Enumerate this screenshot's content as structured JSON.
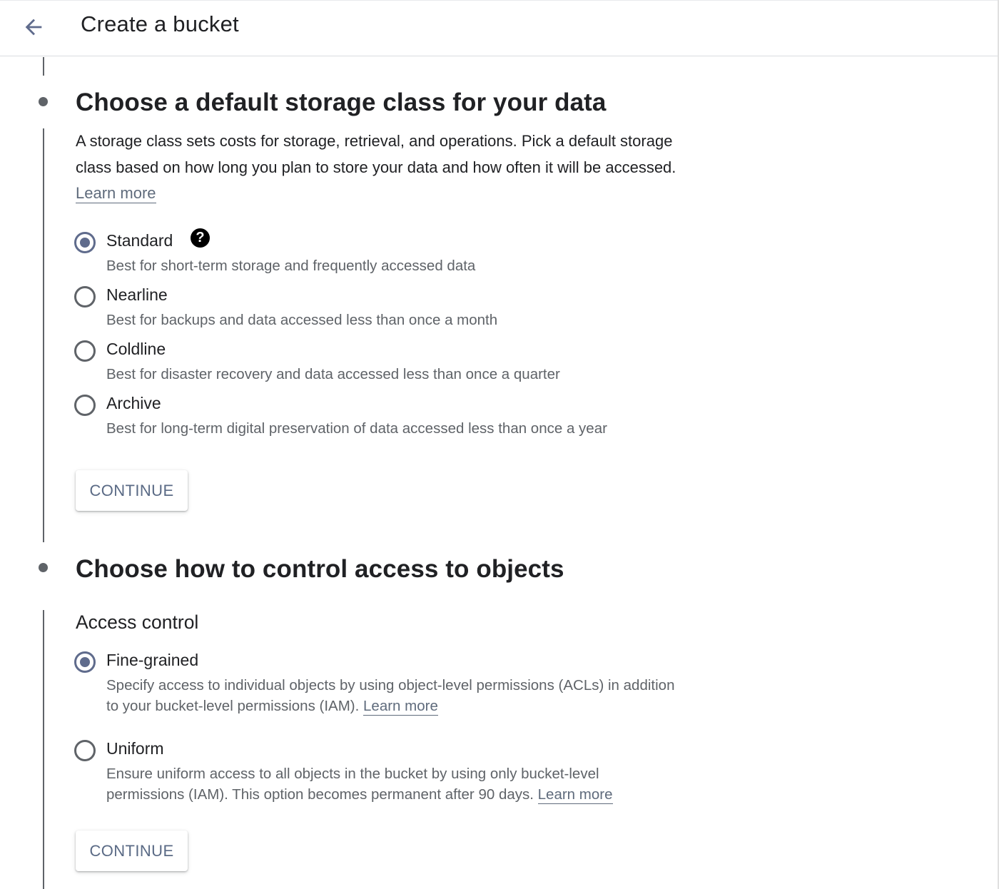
{
  "header": {
    "back_icon": "arrow-left-icon",
    "title": "Create a bucket"
  },
  "storage_section": {
    "title": "Choose a default storage class for your data",
    "description": "A storage class sets costs for storage, retrieval, and operations. Pick a default storage class based on how long you plan to store your data and how often it will be accessed.",
    "learn_more": "Learn more",
    "help_icon": "help-circle-icon",
    "options": [
      {
        "label": "Standard",
        "description": "Best for short-term storage and frequently accessed data",
        "selected": true
      },
      {
        "label": "Nearline",
        "description": "Best for backups and data accessed less than once a month",
        "selected": false
      },
      {
        "label": "Coldline",
        "description": "Best for disaster recovery and data accessed less than once a quarter",
        "selected": false
      },
      {
        "label": "Archive",
        "description": "Best for long-term digital preservation of data accessed less than once a year",
        "selected": false
      }
    ],
    "continue_label": "CONTINUE"
  },
  "access_section": {
    "title": "Choose how to control access to objects",
    "subheading": "Access control",
    "options": [
      {
        "label": "Fine-grained",
        "description": "Specify access to individual objects by using object-level permissions (ACLs) in addition to your bucket-level permissions (IAM).",
        "learn_more": "Learn more",
        "selected": true
      },
      {
        "label": "Uniform",
        "description": "Ensure uniform access to all objects in the bucket by using only bucket-level permissions (IAM). This option becomes permanent after 90 days.",
        "learn_more": "Learn more",
        "selected": false
      }
    ],
    "continue_label": "CONTINUE"
  },
  "colors": {
    "accent": "#5f6b8c",
    "link": "#5f6b7c",
    "text": "#202124",
    "secondary_text": "#5f6368"
  }
}
